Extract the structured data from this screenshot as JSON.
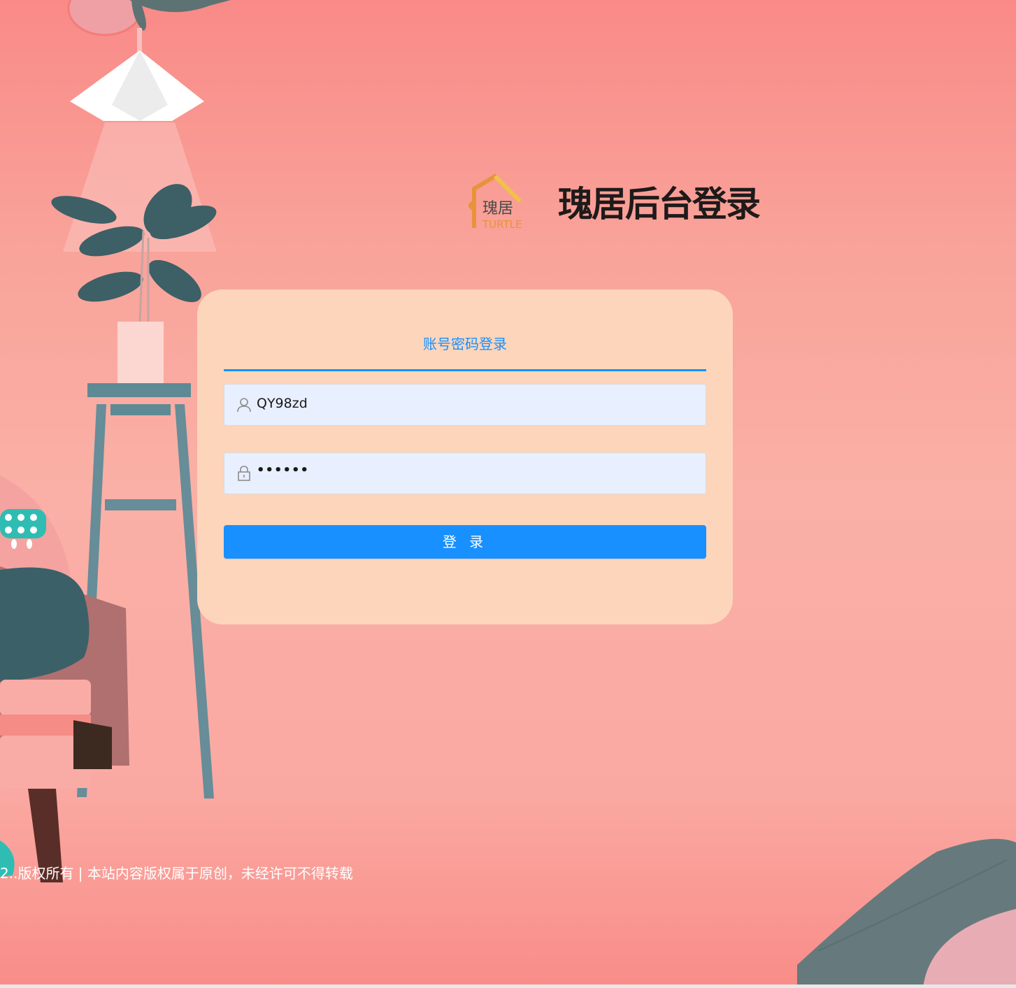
{
  "brand": {
    "logo_text_cn": "瑰居",
    "logo_text_en": "TURTLE",
    "title": "瑰居后台登录"
  },
  "login": {
    "tab_label": "账号密码登录",
    "username": {
      "value": "QY98zd",
      "icon": "user-icon"
    },
    "password": {
      "masked_value": "••••••",
      "icon": "lock-icon"
    },
    "submit_label": "登 录"
  },
  "footer": {
    "text": "2..版权所有 | 本站内容版权属于原创，未经许可不得转载"
  },
  "colors": {
    "accent": "#1890ff",
    "card": "#fdd5bb",
    "input_bg": "#e8efff",
    "title": "#1f1a1a",
    "logo_orange": "#e8933a"
  }
}
